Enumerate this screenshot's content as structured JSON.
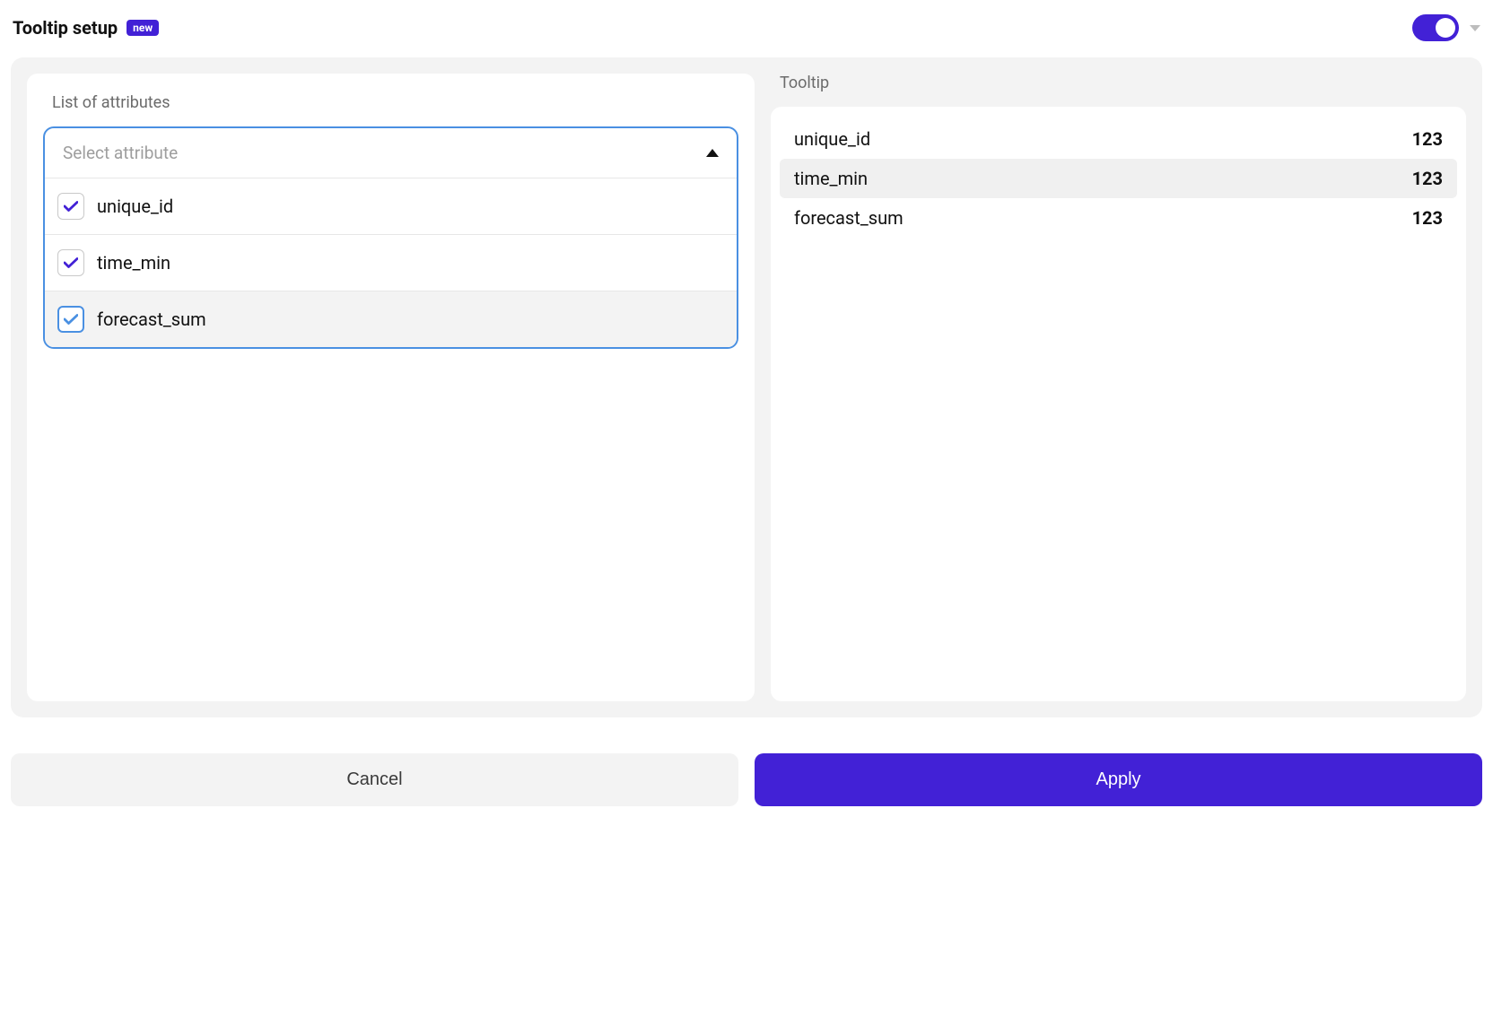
{
  "header": {
    "title": "Tooltip setup",
    "badge": "new",
    "toggle_on": true
  },
  "left_panel": {
    "label": "List of attributes",
    "select_placeholder": "Select attribute",
    "options": [
      {
        "label": "unique_id",
        "checked": true,
        "focused": false,
        "hovered": false
      },
      {
        "label": "time_min",
        "checked": true,
        "focused": false,
        "hovered": false
      },
      {
        "label": "forecast_sum",
        "checked": true,
        "focused": true,
        "hovered": true
      }
    ]
  },
  "right_panel": {
    "label": "Tooltip",
    "rows": [
      {
        "key": "unique_id",
        "value": "123",
        "selected": false
      },
      {
        "key": "time_min",
        "value": "123",
        "selected": true
      },
      {
        "key": "forecast_sum",
        "value": "123",
        "selected": false
      }
    ]
  },
  "footer": {
    "cancel": "Cancel",
    "apply": "Apply"
  }
}
